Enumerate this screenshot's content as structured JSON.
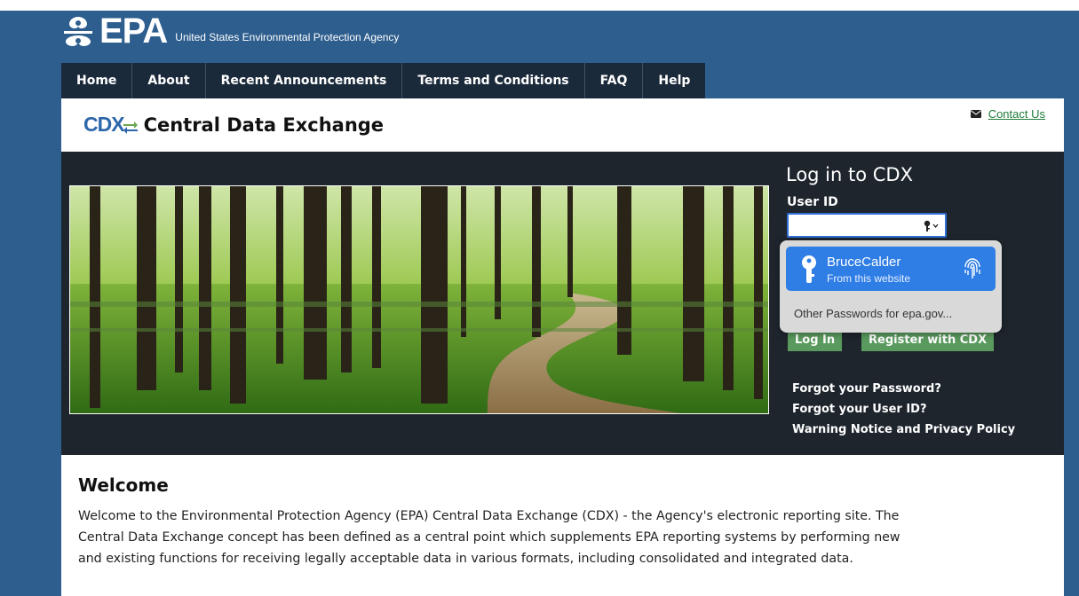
{
  "agency": {
    "logo_text": "EPA",
    "name": "United States Environmental Protection Agency"
  },
  "nav": {
    "items": [
      "Home",
      "About",
      "Recent Announcements",
      "Terms and Conditions",
      "FAQ",
      "Help"
    ]
  },
  "header": {
    "logo_letters": "CDX",
    "title": "Central Data Exchange",
    "contact_label": "Contact Us"
  },
  "login": {
    "title": "Log in to CDX",
    "userid_label": "User ID",
    "userid_value": "",
    "login_button": "Log In",
    "register_button": "Register with CDX",
    "links": [
      "Forgot your Password?",
      "Forgot your User ID?",
      "Warning Notice and Privacy Policy"
    ]
  },
  "autofill": {
    "username": "BruceCalder",
    "source": "From this website",
    "other": "Other Passwords for epa.gov..."
  },
  "welcome": {
    "title": "Welcome",
    "line1": "Welcome to the Environmental Protection Agency (EPA) Central Data Exchange (CDX) - the Agency's electronic reporting site. The",
    "line2": "Central Data Exchange concept has been defined as a central point which supplements EPA reporting systems by performing new",
    "line3": "and existing functions for receiving legally acceptable data in various formats, including consolidated and integrated data."
  },
  "colors": {
    "page_background": "#2e5e8e",
    "nav_background": "#1b2a3a",
    "hero_background": "#1e252d",
    "button_green": "#5a9a5e",
    "autofill_blue": "#2f7ee6",
    "link_green": "#1f7c3a"
  },
  "icons": {
    "epa_mark": "epa-flower-icon",
    "contact": "envelope-icon",
    "field": "key-icon",
    "autofill_key": "key-icon",
    "autofill_auth": "fingerprint-icon"
  }
}
